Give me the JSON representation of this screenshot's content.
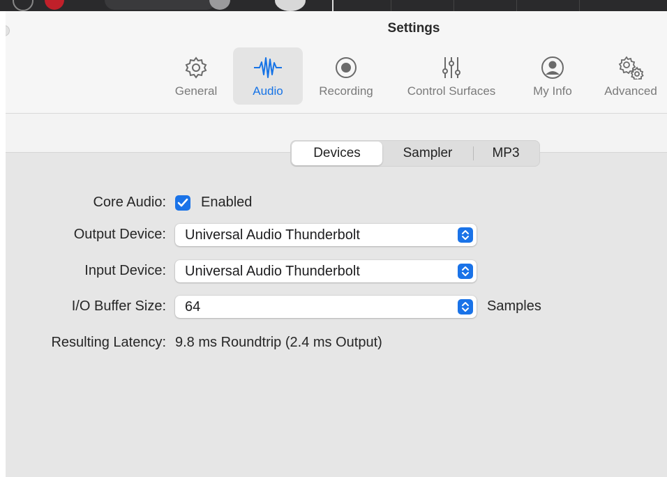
{
  "window": {
    "title": "Settings"
  },
  "toolbar": {
    "items": [
      {
        "label": "General",
        "icon": "gear-icon",
        "active": false
      },
      {
        "label": "Audio",
        "icon": "waveform-icon",
        "active": true
      },
      {
        "label": "Recording",
        "icon": "record-icon",
        "active": false
      },
      {
        "label": "Control Surfaces",
        "icon": "sliders-icon",
        "active": false
      },
      {
        "label": "My Info",
        "icon": "person-circle-icon",
        "active": false
      },
      {
        "label": "Advanced",
        "icon": "gears-icon",
        "active": false
      }
    ]
  },
  "tabs": {
    "items": [
      "Devices",
      "Sampler",
      "MP3"
    ],
    "selected": "Devices"
  },
  "devices": {
    "core_audio": {
      "label": "Core Audio:",
      "checkbox_label": "Enabled",
      "checked": true
    },
    "output_device": {
      "label": "Output Device:",
      "value": "Universal Audio Thunderbolt"
    },
    "input_device": {
      "label": "Input Device:",
      "value": "Universal Audio Thunderbolt"
    },
    "buffer_size": {
      "label": "I/O Buffer Size:",
      "value": "64",
      "unit": "Samples"
    },
    "latency": {
      "label": "Resulting Latency:",
      "value": "9.8 ms Roundtrip (2.4 ms Output)"
    }
  },
  "colors": {
    "accent": "#1a73e8",
    "window_bg": "#e6e6e6",
    "toolbar_bg": "#f6f6f6"
  }
}
